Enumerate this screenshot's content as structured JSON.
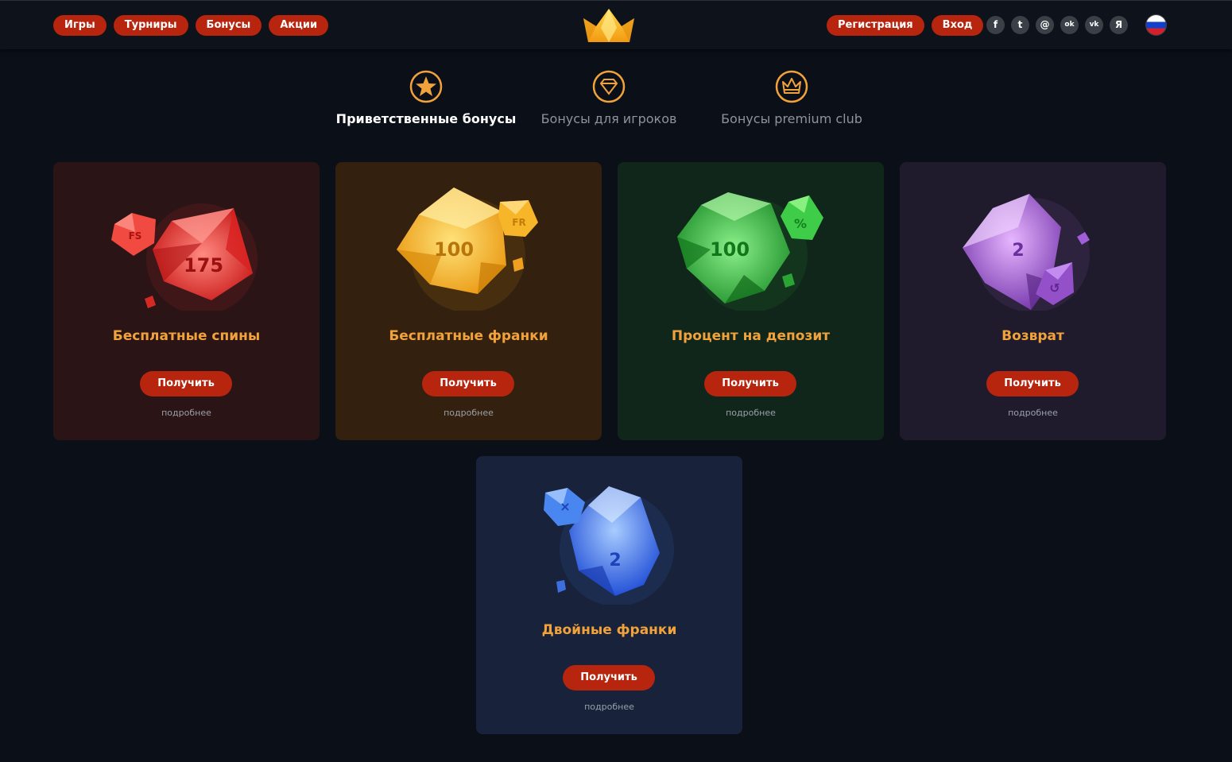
{
  "header": {
    "nav": [
      {
        "label": "Игры"
      },
      {
        "label": "Турниры"
      },
      {
        "label": "Бонусы"
      },
      {
        "label": "Акции"
      }
    ],
    "register_label": "Регистрация",
    "login_label": "Вход",
    "socials": [
      {
        "icon": "facebook-icon",
        "glyph": "f"
      },
      {
        "icon": "twitter-icon",
        "glyph": "t"
      },
      {
        "icon": "mail-icon",
        "glyph": "@"
      },
      {
        "icon": "odnoklassniki-icon",
        "glyph": "ok"
      },
      {
        "icon": "vk-icon",
        "glyph": "vk"
      },
      {
        "icon": "yandex-icon",
        "glyph": "Я"
      }
    ],
    "language_icon": "russia-flag-icon"
  },
  "tabs": [
    {
      "label": "Приветственные бонусы",
      "icon": "star-icon",
      "active": true
    },
    {
      "label": "Бонусы для игроков",
      "icon": "diamond-icon",
      "active": false
    },
    {
      "label": "Бонусы premium club",
      "icon": "crown-icon",
      "active": false
    }
  ],
  "cards": [
    {
      "title": "Бесплатные спины",
      "button": "Получить",
      "more": "подробнее",
      "gem_value": "175",
      "badge": "FS",
      "accent": "#e8302c",
      "bg": "#2a1416"
    },
    {
      "title": "Бесплатные франки",
      "button": "Получить",
      "more": "подробнее",
      "gem_value": "100",
      "badge": "FR",
      "accent": "#f2b322",
      "bg": "#33200e"
    },
    {
      "title": "Процент на депозит",
      "button": "Получить",
      "more": "подробнее",
      "gem_value": "100",
      "badge": "%",
      "accent": "#2fb83b",
      "bg": "#11261a"
    },
    {
      "title": "Возврат",
      "button": "Получить",
      "more": "подробнее",
      "gem_value": "2",
      "badge": "↺",
      "accent": "#b36fe0",
      "bg": "#1f1b2c"
    },
    {
      "title": "Двойные франки",
      "button": "Получить",
      "more": "подробнее",
      "gem_value": "2",
      "badge": "×",
      "accent": "#3d7df0",
      "bg": "#18223a"
    }
  ],
  "colors": {
    "button": "#b8250e",
    "title": "#f2a23a",
    "background": "#0b0f18"
  }
}
